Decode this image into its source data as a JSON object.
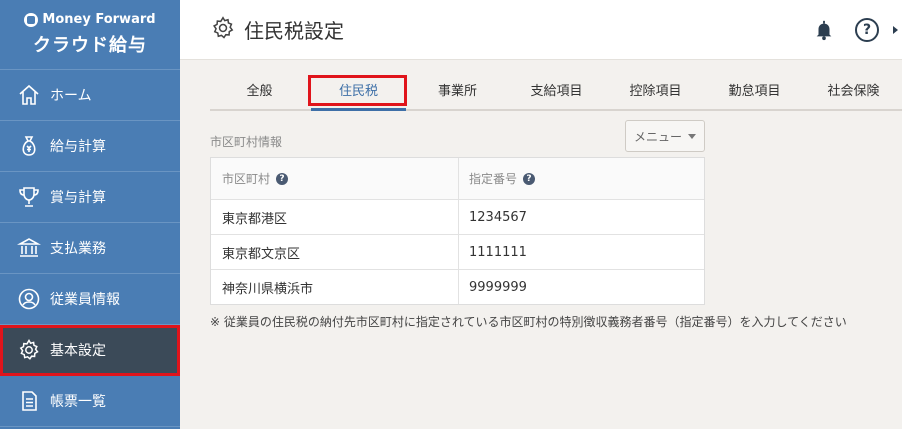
{
  "brand": {
    "top": "Money Forward",
    "bottom": "クラウド給与"
  },
  "sidebar": {
    "items": [
      {
        "label": "ホーム",
        "icon": "home-icon"
      },
      {
        "label": "給与計算",
        "icon": "money-bag-icon"
      },
      {
        "label": "賞与計算",
        "icon": "trophy-icon"
      },
      {
        "label": "支払業務",
        "icon": "bank-icon"
      },
      {
        "label": "従業員情報",
        "icon": "person-icon"
      },
      {
        "label": "基本設定",
        "icon": "gear-icon",
        "active": true
      },
      {
        "label": "帳票一覧",
        "icon": "document-icon"
      }
    ]
  },
  "header": {
    "title": "住民税設定",
    "help": "?"
  },
  "tabs": [
    "全般",
    "住民税",
    "事業所",
    "支給項目",
    "控除項目",
    "勤怠項目",
    "社会保険"
  ],
  "active_tab": "住民税",
  "section": {
    "label": "市区町村情報",
    "menu_label": "メニュー"
  },
  "table": {
    "headers": [
      "市区町村",
      "指定番号"
    ],
    "rows": [
      [
        "東京都港区",
        "1234567"
      ],
      [
        "東京都文京区",
        "1111111"
      ],
      [
        "神奈川県横浜市",
        "9999999"
      ]
    ]
  },
  "note": "※ 従業員の住民税の納付先市区町村に指定されている市区町村の特別徴収義務者番号（指定番号）を入力してください",
  "colors": {
    "sidebar": "#4a7db4",
    "active_nav": "#3b4a58",
    "highlight": "#e0141b",
    "accent": "#3d6fa7"
  }
}
